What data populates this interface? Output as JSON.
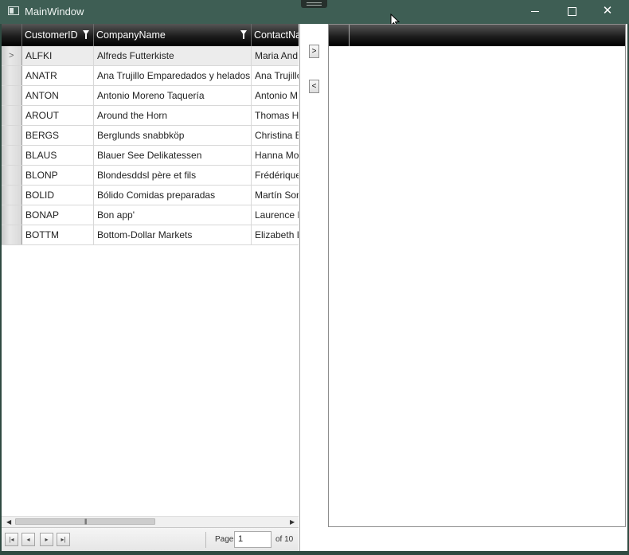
{
  "window": {
    "title": "MainWindow",
    "minimize_icon": "minimize-icon",
    "maximize_icon": "maximize-icon",
    "close_icon": "close-icon"
  },
  "grid": {
    "columns": [
      "CustomerID",
      "CompanyName",
      "ContactNa"
    ],
    "rows": [
      {
        "id": "ALFKI",
        "company": "Alfreds Futterkiste",
        "contact": "Maria And"
      },
      {
        "id": "ANATR",
        "company": "Ana Trujillo Emparedados y helados",
        "contact": "Ana Trujillo"
      },
      {
        "id": "ANTON",
        "company": "Antonio Moreno Taquería",
        "contact": "Antonio M"
      },
      {
        "id": "AROUT",
        "company": "Around the Horn",
        "contact": "Thomas H"
      },
      {
        "id": "BERGS",
        "company": "Berglunds snabbköp",
        "contact": "Christina B"
      },
      {
        "id": "BLAUS",
        "company": "Blauer See Delikatessen",
        "contact": "Hanna Mo"
      },
      {
        "id": "BLONP",
        "company": "Blondesddsl père et fils",
        "contact": "Frédérique"
      },
      {
        "id": "BOLID",
        "company": "Bólido Comidas preparadas",
        "contact": "Martín Sor"
      },
      {
        "id": "BONAP",
        "company": "Bon app'",
        "contact": "Laurence L"
      },
      {
        "id": "BOTTM",
        "company": "Bottom-Dollar Markets",
        "contact": "Elizabeth L"
      }
    ],
    "selected_row_marker": ">"
  },
  "pager": {
    "page_label": "Page",
    "page_value": "1",
    "of_label": "of 10",
    "first_glyph": "|◂",
    "prev_glyph": "◂",
    "next_glyph": "▸",
    "last_glyph": "▸|"
  },
  "transfer": {
    "move_right_label": ">",
    "move_left_label": "<"
  }
}
